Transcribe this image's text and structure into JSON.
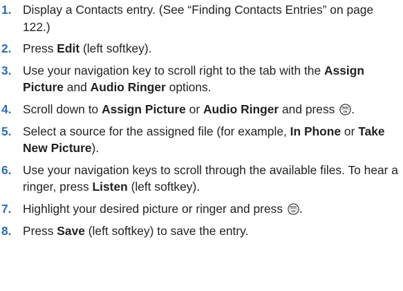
{
  "steps": [
    {
      "number": "1.",
      "parts": [
        "Display a Contacts entry. (See “Finding Contacts Entries” on page 122.)"
      ]
    },
    {
      "number": "2.",
      "parts": [
        "Press ",
        "Edit",
        " (left softkey)."
      ]
    },
    {
      "number": "3.",
      "parts": [
        "Use your navigation key to scroll right to the tab with the ",
        "Assign Picture",
        " and ",
        "Audio Ringer",
        " options."
      ]
    },
    {
      "number": "4.",
      "parts": [
        "Scroll down to ",
        "Assign Picture",
        " or ",
        "Audio Ringer",
        " and press ",
        "."
      ]
    },
    {
      "number": "5.",
      "parts": [
        "Select a source for the assigned file (for example, ",
        "In Phone",
        " or ",
        "Take New Picture",
        ")."
      ]
    },
    {
      "number": "6.",
      "parts": [
        "Use your navigation keys to scroll through the available files. To hear a ringer, press ",
        "Listen",
        " (left softkey)."
      ]
    },
    {
      "number": "7.",
      "parts": [
        "Highlight your desired picture or ringer and press ",
        "."
      ]
    },
    {
      "number": "8.",
      "parts": [
        "Press ",
        "Save",
        " (left softkey) to save the entry."
      ]
    }
  ],
  "key_icon": {
    "name": "menu-ok-key-icon",
    "top_label": "MENU",
    "bottom_label": "OK"
  },
  "colors": {
    "step_number": "#2a6db0",
    "text": "#231f20"
  }
}
